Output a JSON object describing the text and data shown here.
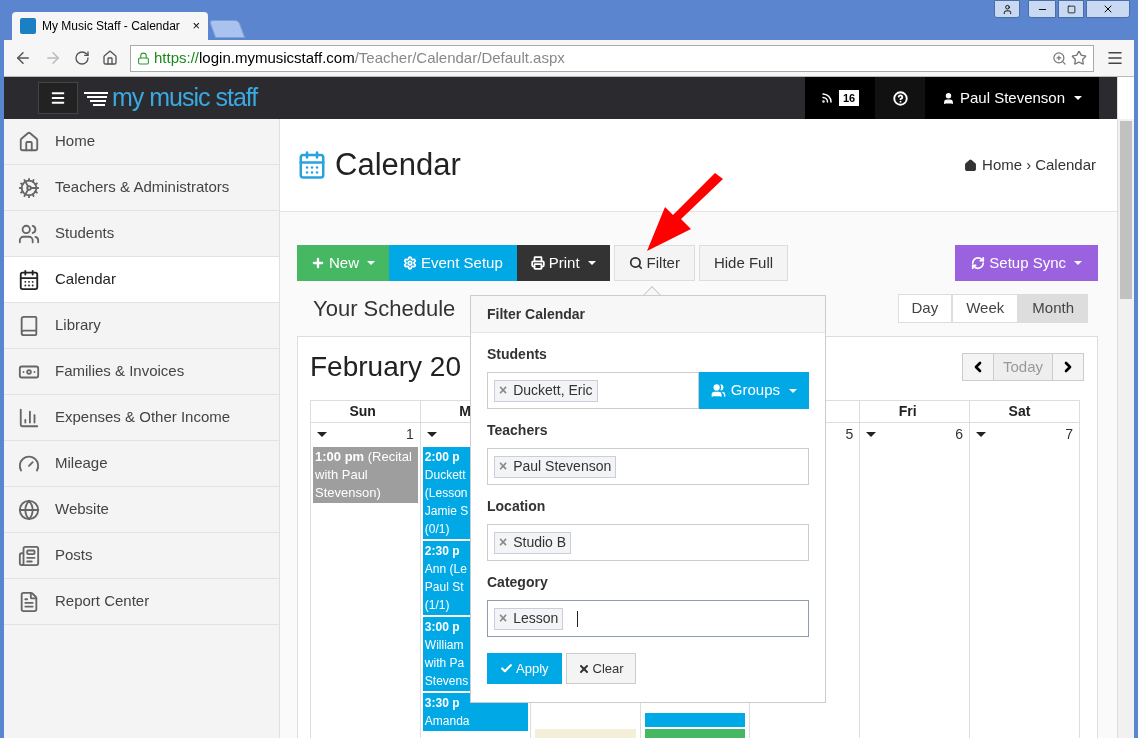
{
  "browser": {
    "tab_title": "My Music Staff - Calendar",
    "tab_close": "×",
    "url_scheme": "https://",
    "url_host": "login.mymusicstaff.com",
    "url_path": "/Teacher/Calendar/Default.aspx"
  },
  "header": {
    "logo": "my music staff",
    "feed_count": "16",
    "user": "Paul Stevenson"
  },
  "sidebar": {
    "items": [
      {
        "label": "Home",
        "selected": false
      },
      {
        "label": "Teachers & Administrators",
        "selected": false
      },
      {
        "label": "Students",
        "selected": false
      },
      {
        "label": "Calendar",
        "selected": true
      },
      {
        "label": "Library",
        "selected": false
      },
      {
        "label": "Families & Invoices",
        "selected": false
      },
      {
        "label": "Expenses & Other Income",
        "selected": false
      },
      {
        "label": "Mileage",
        "selected": false
      },
      {
        "label": "Website",
        "selected": false
      },
      {
        "label": "Posts",
        "selected": false
      },
      {
        "label": "Report Center",
        "selected": false
      }
    ]
  },
  "page": {
    "title": "Calendar",
    "breadcrumb": [
      "Home",
      "›",
      "Calendar"
    ]
  },
  "toolbar": [
    {
      "label": "New",
      "kind": "add",
      "color": "#46b864",
      "dropdown": true
    },
    {
      "label": "Event Setup",
      "kind": "setup",
      "color": "#00a9e6",
      "dropdown": false
    },
    {
      "label": "Print",
      "kind": "print",
      "color": "#333333",
      "dropdown": true
    },
    {
      "label": "Filter",
      "kind": "filter",
      "color": "#f4f4f4",
      "dropdown": false
    },
    {
      "label": "Hide Full",
      "kind": "plain",
      "color": "#f4f4f4",
      "dropdown": false
    }
  ],
  "sync_button": {
    "label": "Setup Sync",
    "color": "#9a62de"
  },
  "schedule_title": "Your Schedule",
  "views": [
    {
      "label": "Day",
      "selected": false
    },
    {
      "label": "Week",
      "selected": false
    },
    {
      "label": "Month",
      "selected": true
    }
  ],
  "month_title": "February 20",
  "today_button": "Today",
  "calendar": {
    "columns": [
      {
        "header": "Sun",
        "date": "1",
        "menu": true,
        "events": [
          {
            "time": "1:00 pm",
            "text": "(Recital with Paul Stevenson)",
            "color": "#9e9e9e"
          }
        ]
      },
      {
        "header": "M",
        "menu": true,
        "events": [
          {
            "time": "2:00 p",
            "lines": [
              "Duckett",
              "(Lesson",
              "Jamie S",
              "(0/1)"
            ],
            "color": "#00a9e6"
          },
          {
            "time": "2:30 p",
            "lines": [
              "Ann (Le",
              "Paul St",
              "(1/1)"
            ],
            "color": "#00a9e6"
          },
          {
            "time": "3:00 p",
            "lines": [
              "William",
              "with Pa",
              "Stevens"
            ],
            "color": "#00a9e6"
          },
          {
            "time": "3:30 p",
            "lines": [
              "Amanda"
            ],
            "color": "#00a9e6"
          }
        ]
      },
      {
        "events": [
          {
            "color": "#f3efd9"
          }
        ]
      },
      {
        "events": [
          {
            "color": "#00a9e6"
          },
          {
            "color": "#46b864"
          }
        ]
      },
      {
        "date": "5"
      },
      {
        "header": "Fri",
        "date": "6",
        "menu": true
      },
      {
        "header": "Sat",
        "date": "7",
        "menu": true
      }
    ]
  },
  "filter": {
    "title": "Filter Calendar",
    "fields": [
      {
        "label": "Students",
        "tags": [
          "Duckett, Eric"
        ],
        "addon": "Groups",
        "focused": false
      },
      {
        "label": "Teachers",
        "tags": [
          "Paul Stevenson"
        ],
        "focused": false
      },
      {
        "label": "Location",
        "tags": [
          "Studio B"
        ],
        "focused": false
      },
      {
        "label": "Category",
        "tags": [
          "Lesson"
        ],
        "focused": true
      }
    ],
    "tag_remove": "×",
    "apply": "Apply",
    "clear": "Clear"
  }
}
